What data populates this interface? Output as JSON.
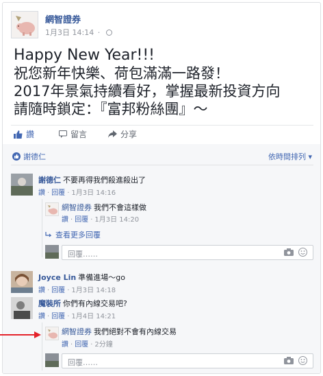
{
  "post": {
    "page_name": "網智證券",
    "date": "1月3日 14:14",
    "separator": "·",
    "lines": [
      "Happy New Year!!!",
      "祝您新年快樂、荷包滿滿一路發！",
      "2017年景氣持續看好，掌握最新投資方向",
      "請隨時鎖定：『富邦粉絲團』～"
    ]
  },
  "actions": {
    "like": "讚",
    "comment": "留言",
    "share": "分享"
  },
  "likes": {
    "name": "謝德仁"
  },
  "sort": {
    "label": "依時間排列 ▾"
  },
  "comments": [
    {
      "author": "謝德仁",
      "text": "不要再得我們殺進殺出了",
      "like": "讚",
      "reply": "回覆",
      "time": "1月3日 14:16",
      "replies": [
        {
          "author": "網智證券",
          "text": "我們不會這樣做",
          "like": "讚",
          "reply": "回覆",
          "time": "1月3日 14:20"
        }
      ],
      "more_replies": "查看更多回覆"
    },
    {
      "author": "Joyce Lin",
      "text": "準備進場～go",
      "like": "讚",
      "reply": "回覆",
      "time": "1月3日 14:18"
    },
    {
      "author": "魔裝所",
      "text": "你們有內線交易吧?",
      "like": "讚",
      "reply": "回覆",
      "time": "1月4日 14:21",
      "replies": [
        {
          "author": "網智證券",
          "text": "我們絕對不會有內線交易",
          "like": "讚",
          "reply": "回覆",
          "time": "2分鐘"
        }
      ]
    }
  ],
  "reply_box": {
    "placeholder": "回覆……"
  },
  "colors": {
    "link": "#365899",
    "accent": "#4267b2",
    "meta": "#90949c",
    "arrow": "#e4222a"
  },
  "icons": [
    "globe-icon",
    "like-icon",
    "comment-icon",
    "share-icon",
    "camera-icon",
    "emoji-icon",
    "reply-arrow-icon",
    "red-arrow-indicator"
  ]
}
